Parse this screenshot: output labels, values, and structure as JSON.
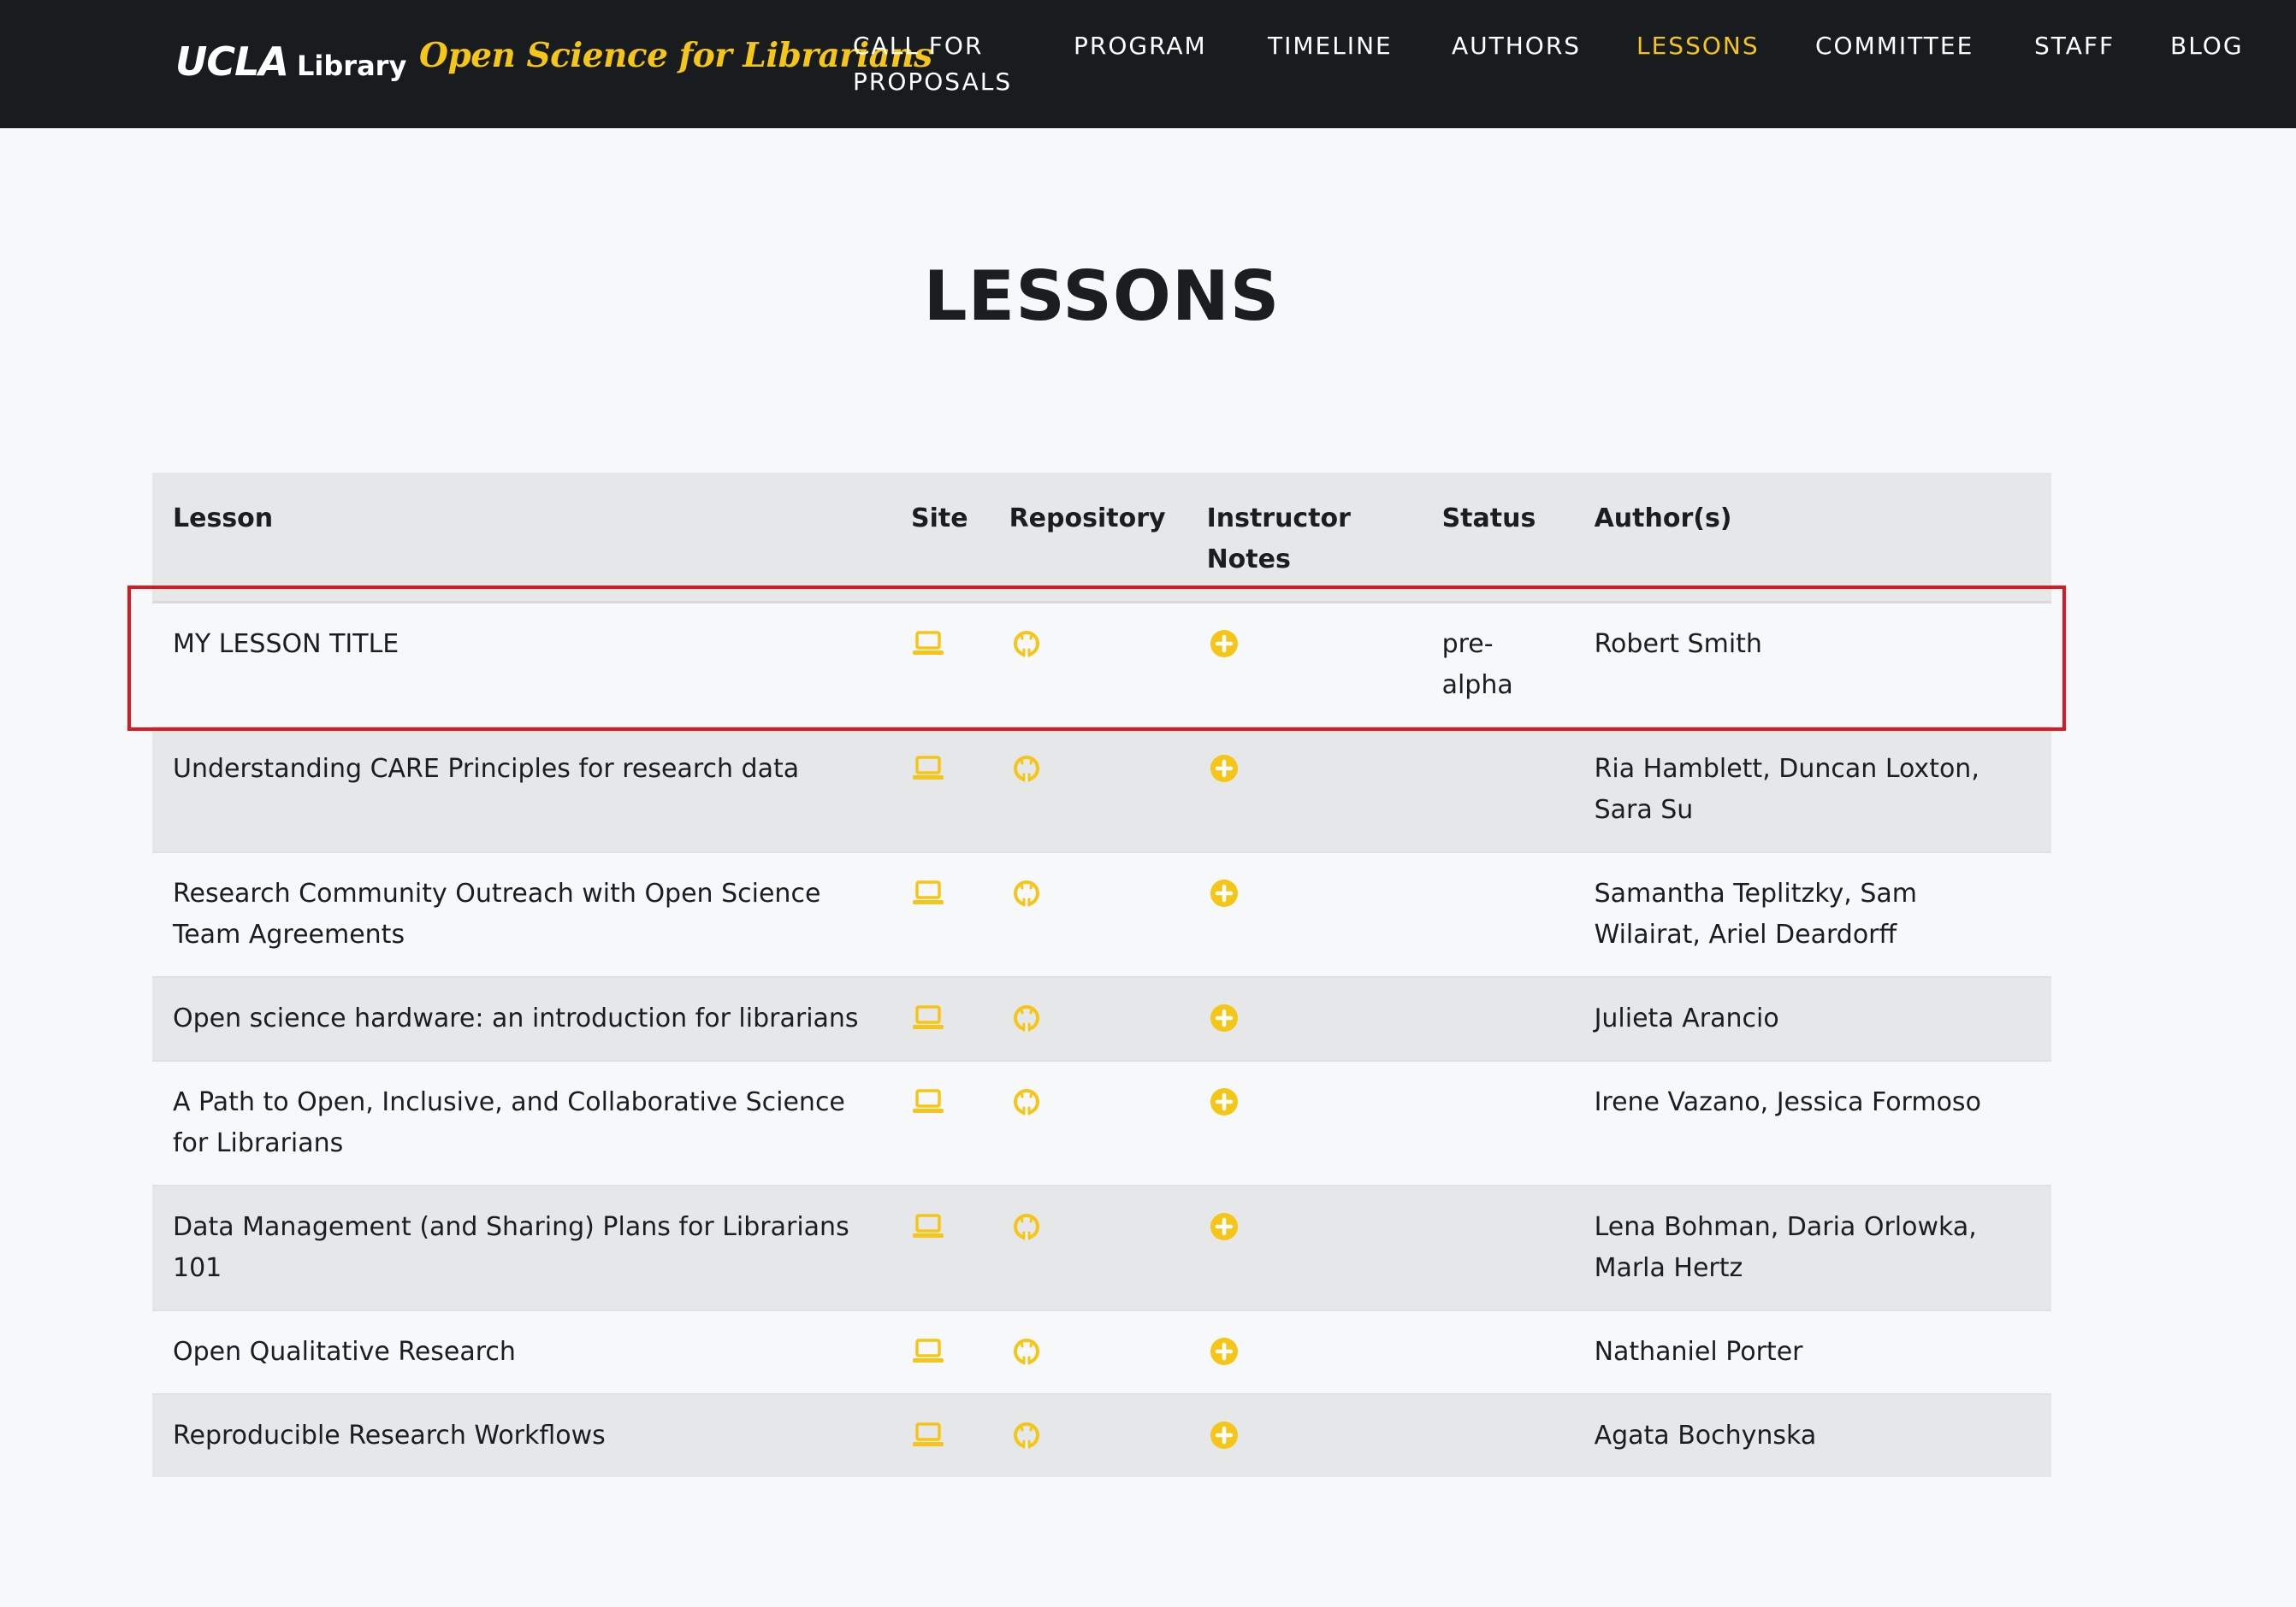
{
  "header": {
    "logo_main": "UCLA",
    "logo_sub": "Library",
    "site_title": "Open Science for Librarians",
    "accent_color": "#f5c518",
    "nav": [
      {
        "label_line1": "CALL FOR",
        "label_line2": "PROPOSALS",
        "active": false
      },
      {
        "label": "PROGRAM",
        "active": false
      },
      {
        "label": "TIMELINE",
        "active": false
      },
      {
        "label": "AUTHORS",
        "active": false
      },
      {
        "label": "LESSONS",
        "active": true
      },
      {
        "label": "COMMITTEE",
        "active": false
      },
      {
        "label": "STAFF",
        "active": false
      },
      {
        "label": "BLOG",
        "active": false
      }
    ]
  },
  "page": {
    "heading": "LESSONS"
  },
  "table": {
    "columns": {
      "lesson": "Lesson",
      "site": "Site",
      "repository": "Repository",
      "notes_line1": "Instructor",
      "notes_line2": "Notes",
      "status": "Status",
      "authors": "Author(s)"
    },
    "icons": {
      "site": "laptop-icon",
      "repository": "github-icon",
      "notes": "plus-circle-icon"
    },
    "rows": [
      {
        "lesson": "MY LESSON TITLE",
        "status_line1": "pre-",
        "status_line2": "alpha",
        "authors": "Robert Smith",
        "highlighted": true
      },
      {
        "lesson": "Understanding CARE Principles for research data",
        "status_line1": "",
        "status_line2": "",
        "authors": "Ria Hamblett, Duncan Loxton, Sara Su"
      },
      {
        "lesson": "Research Community Outreach with Open Science Team Agreements",
        "status_line1": "",
        "status_line2": "",
        "authors": "Samantha Teplitzky, Sam Wilairat, Ariel Deardorff"
      },
      {
        "lesson": "Open science hardware: an introduction for librarians",
        "status_line1": "",
        "status_line2": "",
        "authors": "Julieta Arancio"
      },
      {
        "lesson": "A Path to Open, Inclusive, and Collaborative Science for Librarians",
        "status_line1": "",
        "status_line2": "",
        "authors": "Irene Vazano, Jessica Formoso"
      },
      {
        "lesson": "Data Management (and Sharing) Plans for Librarians 101",
        "status_line1": "",
        "status_line2": "",
        "authors": "Lena Bohman, Daria Orlowka, Marla Hertz"
      },
      {
        "lesson": "Open Qualitative Research",
        "status_line1": "",
        "status_line2": "",
        "authors": "Nathaniel Porter"
      },
      {
        "lesson": "Reproducible Research Workflows",
        "status_line1": "",
        "status_line2": "",
        "authors": "Agata Bochynska"
      }
    ]
  }
}
